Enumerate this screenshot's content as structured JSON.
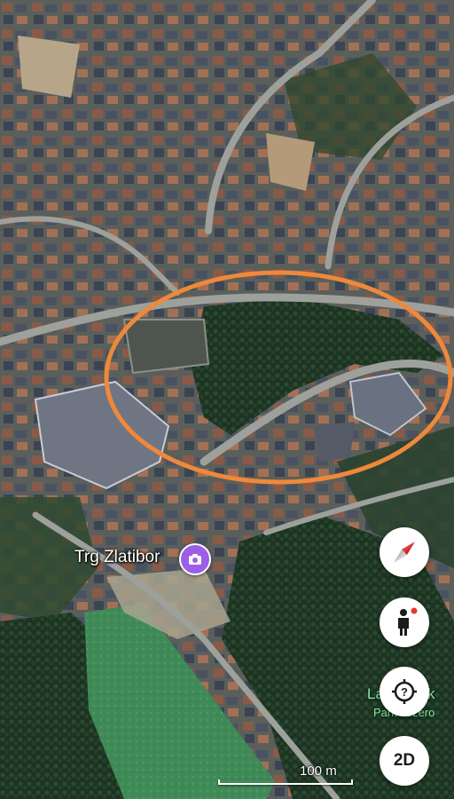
{
  "map": {
    "view": "satellite",
    "labels": {
      "place_name": "Trg Zlatibor",
      "park_name": "Lake Park",
      "park_name_local": "Park Jezero"
    },
    "place_pin_icon": "camera-icon",
    "annotation": {
      "shape": "ellipse",
      "color": "#f0883a"
    },
    "scale": {
      "label": "100 m"
    }
  },
  "controls": {
    "compass": {
      "icon": "compass-needle-icon",
      "colors": [
        "#e53935",
        "#d0d0d0"
      ]
    },
    "street_view": {
      "icon": "pegman-icon",
      "dot_color": "#e53935"
    },
    "location": {
      "icon": "location-target-question-icon"
    },
    "view_toggle": {
      "label": "2D"
    }
  },
  "colors": {
    "pin": "#9c5ee6",
    "park_label": "#8fe3a2",
    "forest": "#1f3a26",
    "lawn": "#4a8f5e"
  }
}
